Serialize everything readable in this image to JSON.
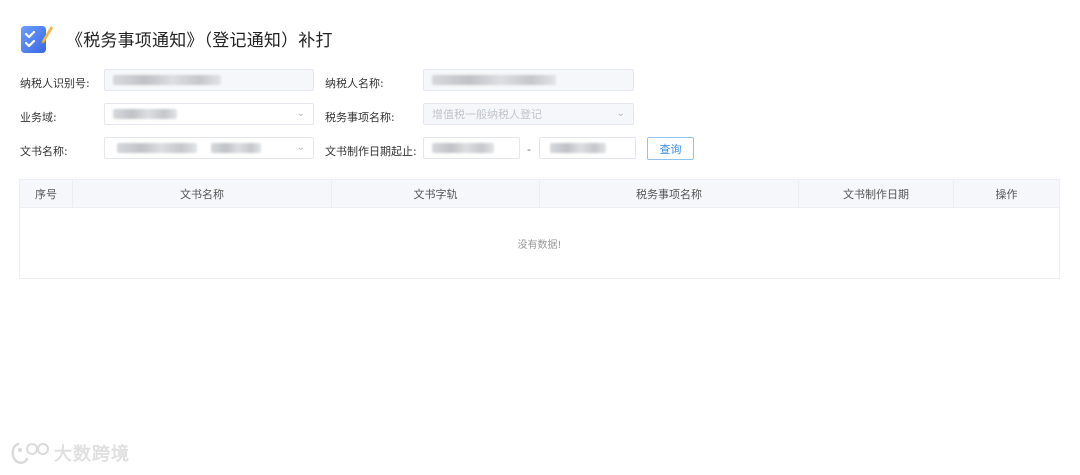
{
  "header": {
    "icon": "edit-checklist-icon",
    "title": "《税务事项通知》（登记通知）补打"
  },
  "form": {
    "taxpayer_id_label": "纳税人识别号:",
    "taxpayer_name_label": "纳税人名称:",
    "business_domain_label": "业务域:",
    "tax_matter_name_label": "税务事项名称:",
    "tax_matter_name_value": "增值税一般纳税人登记",
    "document_name_label": "文书名称:",
    "document_date_label": "文书制作日期起止:",
    "date_separator": "-",
    "query_button": "查询"
  },
  "table": {
    "columns": [
      "序号",
      "文书名称",
      "文书字轨",
      "税务事项名称",
      "文书制作日期",
      "操作"
    ],
    "rows": [],
    "empty_text": "没有数据!"
  },
  "watermark": {
    "text": "大数跨境"
  },
  "colors": {
    "accent": "#3a8ee6",
    "border": "#e4e7ed",
    "table_header_bg": "#f5f7fa"
  }
}
